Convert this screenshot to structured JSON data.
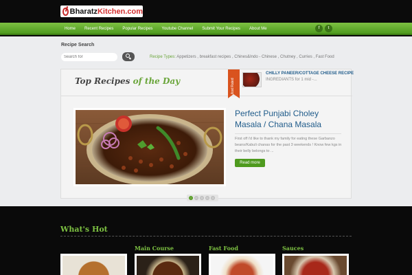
{
  "header": {
    "logo_a": "Bharatz",
    "logo_b": "Kitchen.com"
  },
  "nav": {
    "items": [
      "Home",
      "Recent Recipes",
      "Popular Recipes",
      "Youtube Channel",
      "Submit Your Recipes",
      "About Me"
    ],
    "social": [
      "f",
      "t"
    ]
  },
  "search": {
    "title": "Recipe Search",
    "placeholder": "Search for",
    "types_label": "Recipe Types:",
    "types_list": "Appetizers , breakfast recipes , Chines&Indo - Chinese , Chutney , Curries , Fast Food"
  },
  "top_recipes": {
    "title_a": "Top Recipes ",
    "title_b": "of the Day",
    "ribbon": "Most Rated",
    "side_title": "CHILLY PANEER/COTTAGE CHEESE RECIPE",
    "side_excerpt": "INGREDIANTS for 1 mid -...",
    "post_title": "Perfect Punjabi Choley Masala / Chana Masala",
    "post_excerpt": "First off i'd like to thank my family for eating these Garbanzo beans/Kabuli chanas for the past 3 weekends ! Know few kgs in their belly belongs to ...",
    "read_more": "Read more"
  },
  "whats_hot": {
    "title": "What's Hot",
    "categories": [
      "Main Course",
      "Fast Food",
      "Sauces"
    ]
  },
  "colors": {
    "brand_green": "#6aa53a",
    "link_blue": "#1f5b8a",
    "ribbon_orange": "#d9531e"
  }
}
